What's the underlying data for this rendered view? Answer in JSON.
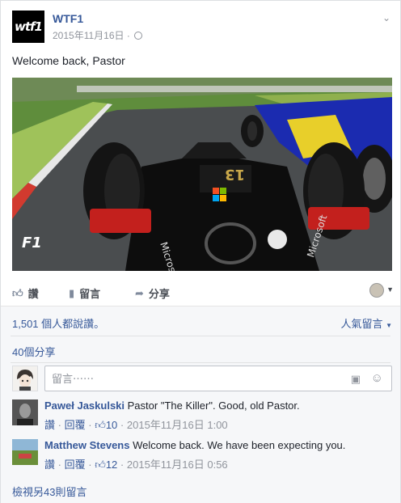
{
  "post": {
    "page_name": "WTF1",
    "avatar_text": "wtf1",
    "timestamp": "2015年11月16日",
    "separator": "·",
    "text": "Welcome back, Pastor"
  },
  "media": {
    "car_number": "13",
    "sponsor": "Microsoft",
    "logo": "F1"
  },
  "actions": {
    "like": "讚",
    "comment": "留言",
    "share": "分享"
  },
  "summary": {
    "likes": "1,501 個人都說讚。",
    "sort": "人氣留言",
    "shares": "40個分享"
  },
  "composer": {
    "placeholder": "留言⋯⋯"
  },
  "comments": [
    {
      "author": "Paweł Jaskulski",
      "text": "Pastor \"The Killer\". Good, old Pastor.",
      "like": "讚",
      "dot": "·",
      "reply": "回覆",
      "reactions": "10",
      "time": "2015年11月16日 1:00"
    },
    {
      "author": "Matthew Stevens",
      "text": "Welcome back. We have been expecting you.",
      "like": "讚",
      "dot": "·",
      "reply": "回覆",
      "reactions": "12",
      "time": "2015年11月16日 0:56"
    }
  ],
  "more_comments": "檢視另43則留言",
  "colors": {
    "link": "#365899",
    "meta": "#90949c",
    "background": "#f6f7f9"
  }
}
